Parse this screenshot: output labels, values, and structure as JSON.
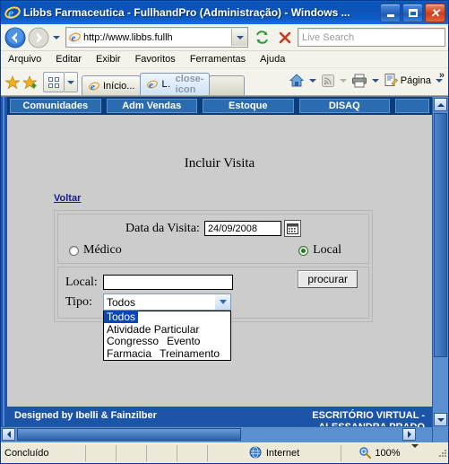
{
  "window": {
    "title": "Libbs Farmaceutica - FullhandPro (Administração) - Windows ...",
    "app_icon": "ie-logo-icon",
    "buttons": {
      "minimize": "–",
      "maximize": "□",
      "close": "✕"
    }
  },
  "addressbar": {
    "back_icon": "back-arrow-icon",
    "forward_icon": "forward-arrow-icon",
    "history_icon": "chevron-down-icon",
    "url": "http://www.libbs.fullh",
    "url_dropdown_icon": "chevron-down-icon",
    "refresh_icon": "refresh-icon",
    "stop_icon": "stop-icon",
    "search_placeholder": "Live Search"
  },
  "menubar": {
    "items": [
      {
        "label": "Arquivo",
        "accel": "A"
      },
      {
        "label": "Editar",
        "accel": "E"
      },
      {
        "label": "Exibir",
        "accel": "x"
      },
      {
        "label": "Favoritos",
        "accel": "F"
      },
      {
        "label": "Ferramentas",
        "accel": "r"
      },
      {
        "label": "Ajuda",
        "accel": "u"
      }
    ]
  },
  "commandbar": {
    "favorites_icon": "star-icon",
    "add_favorite_icon": "star-plus-icon",
    "quick_tabs_icon": "quick-tabs-icon",
    "tab_list_icon": "chevron-down-icon",
    "tabs": [
      {
        "label": "Início...",
        "active": false,
        "icon": "ie-favicon-icon"
      },
      {
        "label": "Li...",
        "active": true,
        "icon": "ie-favicon-icon",
        "close_icon": "close-icon"
      }
    ],
    "home_icon": "home-icon",
    "feeds_icon": "rss-icon",
    "print_icon": "printer-icon",
    "page_icon": "page-icon",
    "page_label": "Página",
    "overflow_label": "»"
  },
  "page": {
    "nav": [
      {
        "label": "Comunidades"
      },
      {
        "label": "Adm Vendas"
      },
      {
        "label": "Estoque"
      },
      {
        "label": "DISAQ"
      },
      {
        "label": ""
      }
    ],
    "title": "Incluir Visita",
    "back_link": "Voltar",
    "form": {
      "date_label": "Data da Visita:",
      "date_value": "24/09/2008",
      "calendar_icon": "calendar-icon",
      "radio_medico": "Médico",
      "radio_local": "Local",
      "radio_selected": "Local",
      "local_label": "Local:",
      "local_value": "",
      "tipo_label": "Tipo:",
      "tipo_value": "Todos",
      "tipo_options": [
        "Todos",
        "Atividade Particular",
        "Congresso",
        "Evento",
        "Farmacia",
        "Treinamento"
      ],
      "tipo_selected": "Todos",
      "search_button": "procurar"
    },
    "footer_left": "Designed by Ibelli & Fainzilber",
    "footer_right_line1": "ESCRITÓRIO VIRTUAL -",
    "footer_right_line2": "ALESSANDRA PRADO"
  },
  "statusbar": {
    "status": "Concluído",
    "zone_icon": "globe-icon",
    "zone": "Internet",
    "zoom_icon": "magnifier-icon",
    "zoom": "100%",
    "zoom_dropdown_icon": "chevron-down-icon"
  },
  "colors": {
    "title_blue": "#0b53b6",
    "nav_blue": "#2b6cb0",
    "nav_bar_dark": "#0c3c7c",
    "footer_blue": "#1c55a8",
    "page_bg": "#cccccc",
    "link_blue": "#1a1a8c",
    "dropdown_highlight": "#0a46b4",
    "radio_green": "#1f7a1f"
  }
}
